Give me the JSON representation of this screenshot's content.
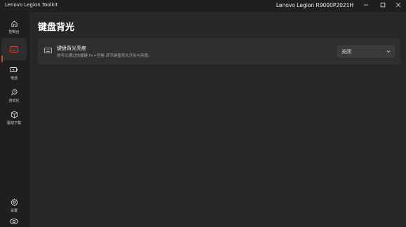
{
  "titlebar": {
    "app_title": "Lenovo Legion Toolkit",
    "device_name": "Lenovo Legion R9000P2021H"
  },
  "sidebar": {
    "items": [
      {
        "label": "控制台",
        "icon": "home-icon"
      },
      {
        "label": "",
        "icon": "keyboard-icon",
        "active": true
      },
      {
        "label": "电池",
        "icon": "battery-icon"
      },
      {
        "label": "自动化",
        "icon": "automation-icon"
      },
      {
        "label": "驱动下载",
        "icon": "package-icon"
      },
      {
        "label": "设置",
        "icon": "gear-icon"
      },
      {
        "label": "",
        "icon": "tray-icon"
      }
    ]
  },
  "page": {
    "title": "键盘背光"
  },
  "backlight_card": {
    "title": "键盘背光亮度",
    "description": "你可以通过快捷键 Fn+空格 调节键盘背光开关与亮度。",
    "select_value": "关闭"
  },
  "colors": {
    "accent": "#c84a36",
    "background": "#272727",
    "sidebar": "#1f1f1f",
    "card": "#2f2f2f"
  }
}
